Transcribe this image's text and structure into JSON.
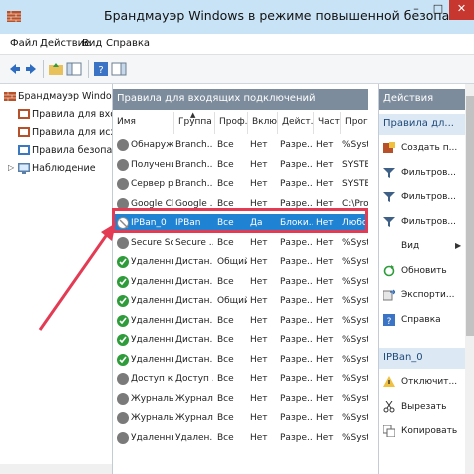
{
  "window": {
    "title": "Брандмауэр Windows в режиме повышенной безопасности"
  },
  "menu": [
    "Файл",
    "Действие",
    "Вид",
    "Справка"
  ],
  "tree": [
    {
      "label": "Брандмауэр Windows в р",
      "icon": "firewall-icon"
    },
    {
      "label": "Правила для входящ",
      "icon": "inbound-rules-icon"
    },
    {
      "label": "Правила для исходящ",
      "icon": "outbound-rules-icon"
    },
    {
      "label": "Правила безопасност",
      "icon": "security-rules-icon"
    },
    {
      "label": "Наблюдение",
      "icon": "monitoring-icon"
    }
  ],
  "list": {
    "header": "Правила для входящих подключений",
    "columns": [
      "Имя",
      "Группа",
      "Проф...",
      "Вклю...",
      "Дейст...",
      "Част...",
      "Прог..."
    ],
    "rows": [
      {
        "name": "Обнаруже...",
        "group": "Branch...",
        "profile": "Все",
        "enabled": "Нет",
        "action": "Разре...",
        "override": "Нет",
        "program": "%Syst...",
        "status": "gray"
      },
      {
        "name": "Получени...",
        "group": "Branch...",
        "profile": "Все",
        "enabled": "Нет",
        "action": "Разре...",
        "override": "Нет",
        "program": "SYSTEM",
        "status": "gray"
      },
      {
        "name": "Сервер ра...",
        "group": "Branch...",
        "profile": "Все",
        "enabled": "Нет",
        "action": "Разре...",
        "override": "Нет",
        "program": "SYSTEM",
        "status": "gray"
      },
      {
        "name": "Google Chr...",
        "group": "Google ...",
        "profile": "Все",
        "enabled": "Нет",
        "action": "Разре...",
        "override": "Нет",
        "program": "C:\\Pro...",
        "status": "gray"
      },
      {
        "name": "IPBan_0",
        "group": "IPBan",
        "profile": "Все",
        "enabled": "Да",
        "action": "Блоки...",
        "override": "Нет",
        "program": "Любой",
        "status": "block"
      },
      {
        "name": "Secure Soc...",
        "group": "Secure ...",
        "profile": "Все",
        "enabled": "Нет",
        "action": "Разре...",
        "override": "Нет",
        "program": "%Syst...",
        "status": "gray"
      },
      {
        "name": "Удаленны...",
        "group": "Дистан...",
        "profile": "Общий",
        "enabled": "Нет",
        "action": "Разре...",
        "override": "Нет",
        "program": "%Syst...",
        "status": "green"
      },
      {
        "name": "Удаленны...",
        "group": "Дистан...",
        "profile": "Все",
        "enabled": "Нет",
        "action": "Разре...",
        "override": "Нет",
        "program": "%Syst...",
        "status": "green"
      },
      {
        "name": "Удаленны...",
        "group": "Дистан...",
        "profile": "Общий",
        "enabled": "Нет",
        "action": "Разре...",
        "override": "Нет",
        "program": "%Syst...",
        "status": "green"
      },
      {
        "name": "Удаленны...",
        "group": "Дистан...",
        "profile": "Все",
        "enabled": "Нет",
        "action": "Разре...",
        "override": "Нет",
        "program": "%Syst...",
        "status": "green"
      },
      {
        "name": "Удаленны...",
        "group": "Дистан...",
        "profile": "Все",
        "enabled": "Нет",
        "action": "Разре...",
        "override": "Нет",
        "program": "%Syst...",
        "status": "green"
      },
      {
        "name": "Удаленны...",
        "group": "Дистан...",
        "profile": "Все",
        "enabled": "Нет",
        "action": "Разре...",
        "override": "Нет",
        "program": "%Syst...",
        "status": "green"
      },
      {
        "name": "Доступ к с...",
        "group": "Доступ ...",
        "profile": "Все",
        "enabled": "Нет",
        "action": "Разре...",
        "override": "Нет",
        "program": "%Syst...",
        "status": "gray"
      },
      {
        "name": "Журналы ...",
        "group": "Журнал...",
        "profile": "Все",
        "enabled": "Нет",
        "action": "Разре...",
        "override": "Нет",
        "program": "%Syst...",
        "status": "gray"
      },
      {
        "name": "Журналы ...",
        "group": "Журнал...",
        "profile": "Все",
        "enabled": "Нет",
        "action": "Разре...",
        "override": "Нет",
        "program": "%Syst...",
        "status": "gray"
      },
      {
        "name": "Удаленны...",
        "group": "Удален...",
        "profile": "Все",
        "enabled": "Нет",
        "action": "Разре...",
        "override": "Нет",
        "program": "%Syst...",
        "status": "gray"
      }
    ]
  },
  "actions": {
    "title": "Действия",
    "section1": "Правила дл...",
    "section1_items": [
      {
        "label": "Создать п...",
        "icon": "new-rule-icon"
      },
      {
        "label": "Фильтров...",
        "icon": "filter-icon"
      },
      {
        "label": "Фильтров...",
        "icon": "filter-icon"
      },
      {
        "label": "Фильтров...",
        "icon": "filter-icon"
      },
      {
        "label": "Вид",
        "icon": ""
      },
      {
        "label": "Обновить",
        "icon": "refresh-icon"
      },
      {
        "label": "Экспорти...",
        "icon": "export-icon"
      },
      {
        "label": "Справка",
        "icon": "help-icon"
      }
    ],
    "section2": "IPBan_0",
    "section2_items": [
      {
        "label": "Отключит...",
        "icon": "disable-icon"
      },
      {
        "label": "Вырезать",
        "icon": "cut-icon"
      },
      {
        "label": "Копировать",
        "icon": "copy-icon"
      }
    ]
  },
  "colors": {
    "selected": "#1f82d3",
    "highlight": "#e23b53",
    "header": "#7d8c9c",
    "section": "#dce8f4"
  }
}
